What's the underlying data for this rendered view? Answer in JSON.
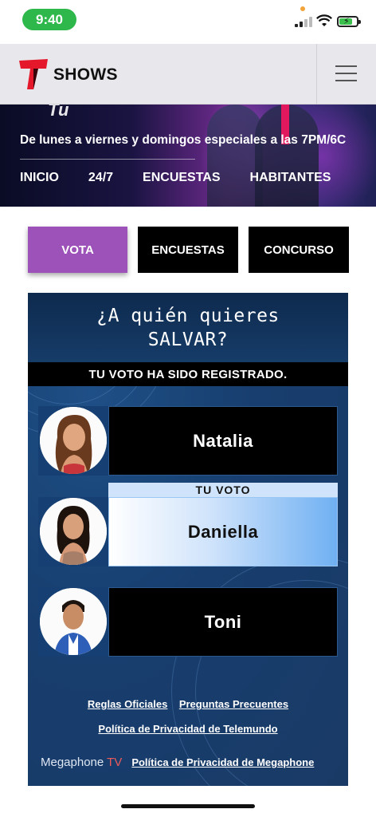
{
  "status_bar": {
    "time": "9:40"
  },
  "header": {
    "brand": "SHOWS"
  },
  "hero": {
    "script_text": "Tu",
    "subtitle": "De lunes a viernes y domingos especiales a las 7PM/6C",
    "nav": [
      "INICIO",
      "24/7",
      "ENCUESTAS",
      "HABITANTES"
    ]
  },
  "tabs": [
    {
      "label": "VOTA",
      "active": true
    },
    {
      "label": "ENCUESTAS",
      "active": false
    },
    {
      "label": "CONCURSO",
      "active": false
    }
  ],
  "widget": {
    "question_line1": "¿A quién quieres",
    "question_line2": "SALVAR?",
    "confirmation": "TU VOTO HA SIDO REGISTRADO.",
    "your_vote_label": "TU VOTO",
    "candidates": [
      {
        "name": "Natalia",
        "selected": false
      },
      {
        "name": "Daniella",
        "selected": true
      },
      {
        "name": "Toni",
        "selected": false
      }
    ],
    "links": {
      "rules": "Reglas Oficiales",
      "faq": "Preguntas Precuentes",
      "privacy_telemundo": "Política de Privacidad de Telemundo",
      "megaphone_brand": "Megaphone",
      "megaphone_tv": "TV",
      "privacy_megaphone": "Política de Privacidad de Megaphone"
    }
  },
  "colors": {
    "status_time_pill": "#2eb84b",
    "accent_tab": "#9c52b8",
    "widget_bg": "#173e6e",
    "telemundo_red": "#e4172b"
  }
}
